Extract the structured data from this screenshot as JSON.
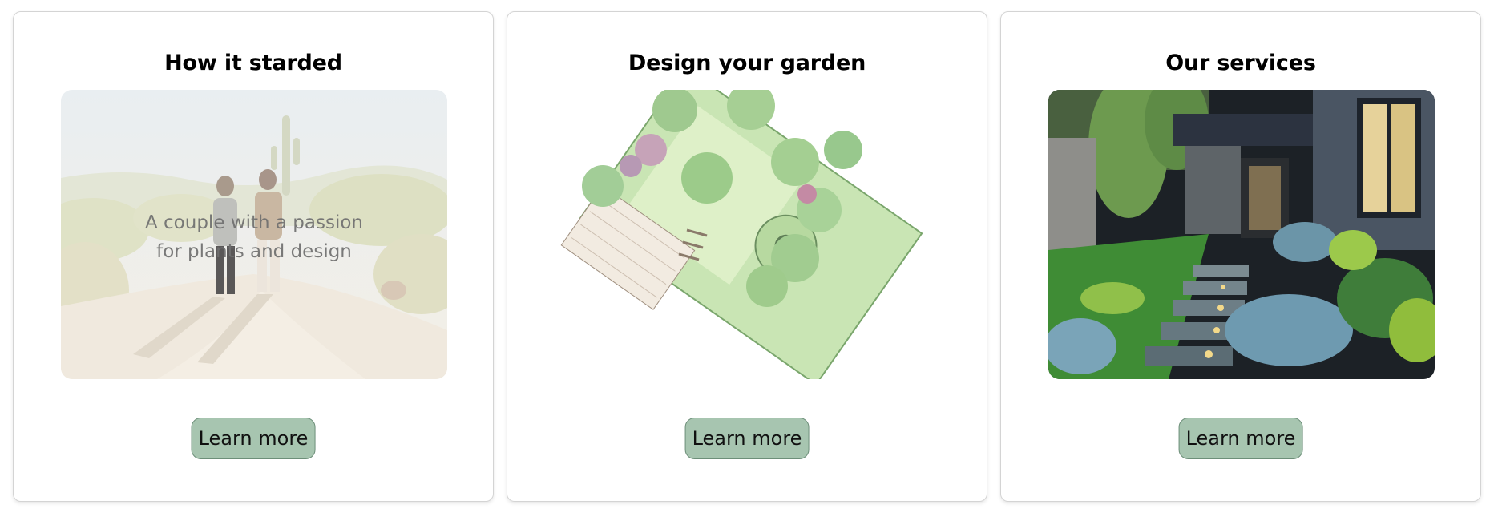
{
  "cards": [
    {
      "title": "How it starded",
      "overlay_line1": "A couple with a passion",
      "overlay_line2": "for plants and design",
      "button_label": "Learn more"
    },
    {
      "title": "Design your garden",
      "button_label": "Learn more"
    },
    {
      "title": "Our services",
      "button_label": "Learn more"
    }
  ],
  "colors": {
    "button_bg": "#a7c5b0",
    "button_border": "#6d8f79",
    "card_border": "#d4d4d4"
  }
}
